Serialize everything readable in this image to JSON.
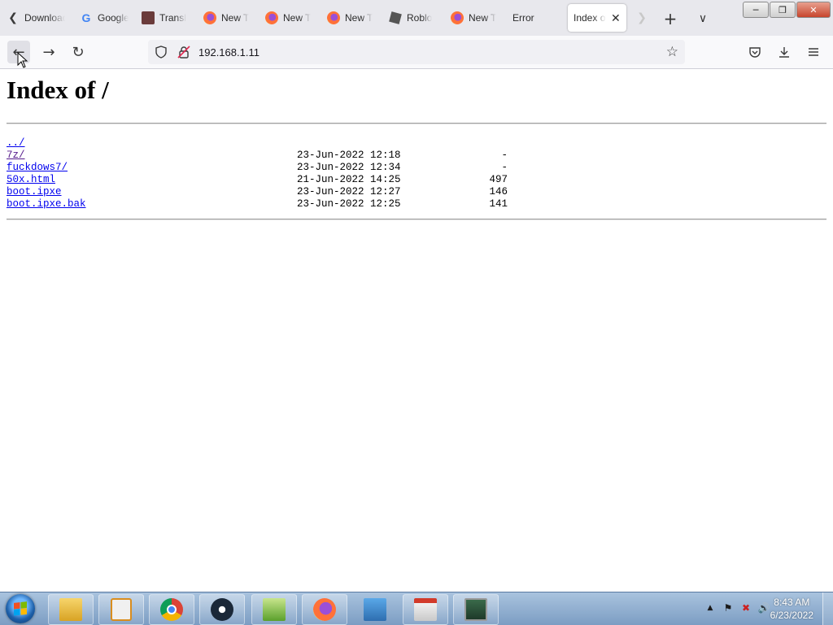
{
  "browser": {
    "tabs": [
      {
        "label": "Download",
        "icon": "download-icon",
        "active": false
      },
      {
        "label": "Google",
        "icon": "google-icon",
        "active": false
      },
      {
        "label": "Transl",
        "icon": "translate-icon",
        "active": false
      },
      {
        "label": "New T",
        "icon": "firefox-icon",
        "active": false
      },
      {
        "label": "New T",
        "icon": "firefox-icon",
        "active": false
      },
      {
        "label": "New T",
        "icon": "firefox-icon",
        "active": false
      },
      {
        "label": "Roblo",
        "icon": "roblox-icon",
        "active": false
      },
      {
        "label": "New T",
        "icon": "firefox-icon",
        "active": false
      },
      {
        "label": "Error",
        "icon": "none",
        "active": false
      },
      {
        "label": "Index of",
        "icon": "none",
        "active": true
      }
    ],
    "address": "192.168.1.11"
  },
  "page": {
    "heading": "Index of /",
    "entries": [
      {
        "name": "../",
        "date": "",
        "size": "",
        "visited": false
      },
      {
        "name": "7z/",
        "date": "23-Jun-2022 12:18",
        "size": "-",
        "visited": true
      },
      {
        "name": "fuckdows7/",
        "date": "23-Jun-2022 12:34",
        "size": "-",
        "visited": false
      },
      {
        "name": "50x.html",
        "date": "21-Jun-2022 14:25",
        "size": "497",
        "visited": false
      },
      {
        "name": "boot.ipxe",
        "date": "23-Jun-2022 12:27",
        "size": "146",
        "visited": false
      },
      {
        "name": "boot.ipxe.bak",
        "date": "23-Jun-2022 12:25",
        "size": "141",
        "visited": false
      }
    ]
  },
  "taskbar": {
    "apps": [
      {
        "name": "windows-explorer-icon",
        "cls": "ic-explorer"
      },
      {
        "name": "media-player-icon",
        "cls": "ic-media"
      },
      {
        "name": "chrome-icon",
        "cls": "ic-chrome"
      },
      {
        "name": "steam-icon",
        "cls": "ic-steam"
      },
      {
        "name": "notepad-plus-plus-icon",
        "cls": "ic-notepad"
      },
      {
        "name": "firefox-icon",
        "cls": "ic-firefox"
      },
      {
        "name": "network-icon",
        "cls": "ic-network"
      },
      {
        "name": "usb-tool-icon",
        "cls": "ic-usb"
      },
      {
        "name": "monitor-icon",
        "cls": "ic-monitor"
      }
    ],
    "clock": {
      "time": "8:43 AM",
      "date": "6/23/2022"
    }
  },
  "colors": {
    "link": "#0000ee",
    "visited_link": "#551a8b",
    "taskbar": "#8fb0d3"
  }
}
